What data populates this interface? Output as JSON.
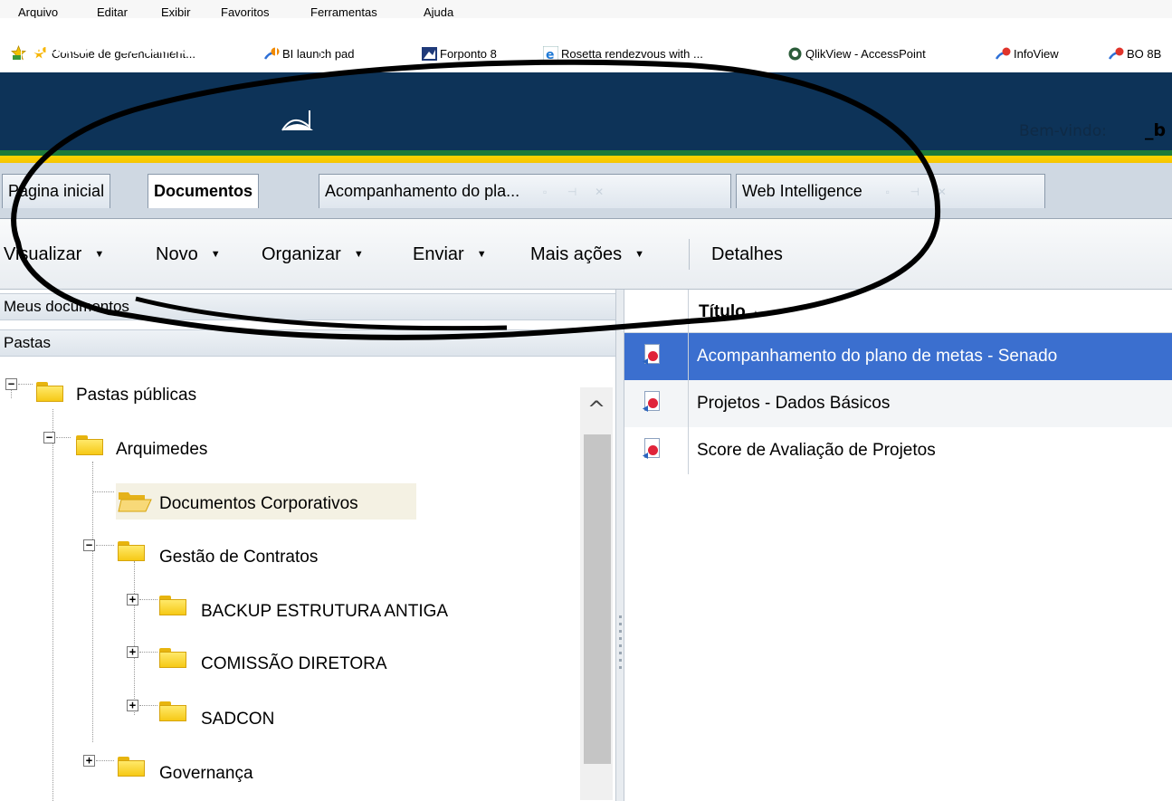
{
  "menu": [
    "Arquivo",
    "Editar",
    "Exibir",
    "Favoritos",
    "Ferramentas",
    "Ajuda"
  ],
  "favorites": [
    {
      "label": "Console de gerenciament...",
      "icon": "gear-star-icon"
    },
    {
      "label": "BI launch pad",
      "icon": "bo-icon"
    },
    {
      "label": "Forponto 8",
      "icon": "forponto-icon"
    },
    {
      "label": "Rosetta rendezvous with ...",
      "icon": "ie-icon"
    },
    {
      "label": "QlikView - AccessPoint",
      "icon": "qlik-icon"
    },
    {
      "label": "InfoView",
      "icon": "bo-icon"
    },
    {
      "label": "BO 8B",
      "icon": "bo-icon"
    }
  ],
  "header": {
    "logo": "SENADO FEDERAL",
    "welcome": "Bem-vindo:",
    "user": "_b"
  },
  "tabs": [
    {
      "label": "Página inicial",
      "active": false
    },
    {
      "label": "Documentos",
      "active": true
    },
    {
      "label": "Acompanhamento do pla...",
      "active": false
    },
    {
      "label": "Web Intelligence",
      "active": false
    }
  ],
  "toolbar": {
    "visualizar": "Visualizar",
    "novo": "Novo",
    "organizar": "Organizar",
    "enviar": "Enviar",
    "mais_acoes": "Mais ações",
    "detalhes": "Detalhes"
  },
  "left": {
    "meus_documentos": "Meus documentos",
    "pastas": "Pastas",
    "tree": {
      "root": "Pastas públicas",
      "arquimedes": "Arquimedes",
      "documentos_corporativos": "Documentos Corporativos",
      "gestao_contratos": "Gestão de Contratos",
      "backup": "BACKUP ESTRUTURA ANTIGA",
      "comissao": "COMISSÃO DIRETORA",
      "sadcon": "SADCON",
      "governanca": "Governança"
    }
  },
  "right": {
    "column_title": "Título",
    "rows": [
      "Acompanhamento do plano de metas - Senado",
      "Projetos - Dados Básicos",
      "Score de Avaliação de Projetos"
    ]
  }
}
